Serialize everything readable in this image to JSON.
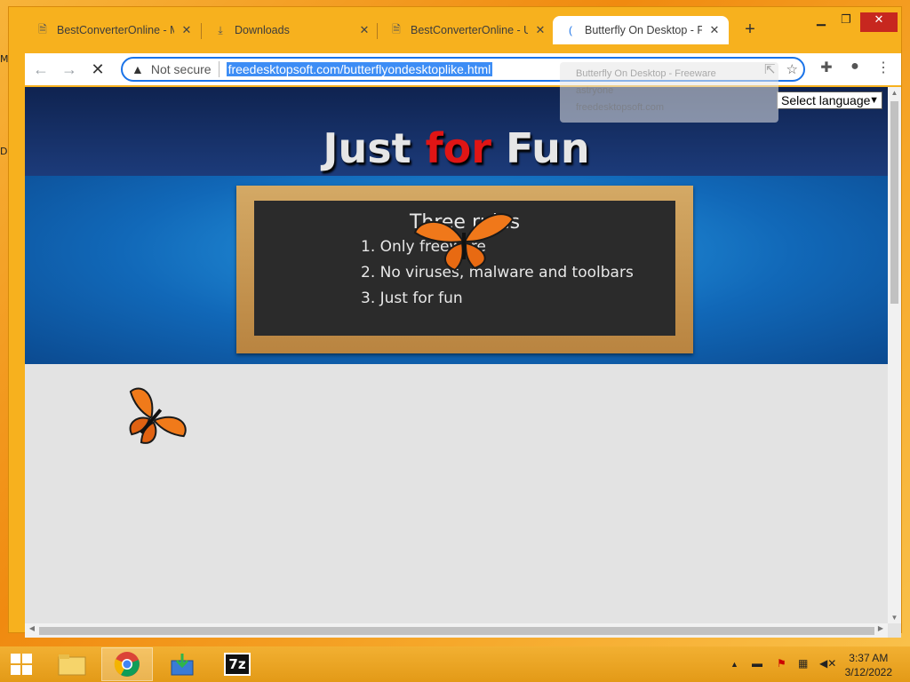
{
  "tabs": [
    {
      "label": "BestConverterOnline - M",
      "icon": "document-icon"
    },
    {
      "label": "Downloads",
      "icon": "download-icon"
    },
    {
      "label": "BestConverterOnline - Us",
      "icon": "document-icon"
    },
    {
      "label": "Butterfly On Desktop - Fr",
      "icon": "loading-icon",
      "active": true
    }
  ],
  "toolbar": {
    "security_label": "Not secure",
    "url": "freedesktopsoft.com/butterflyondesktoplike.html"
  },
  "omnibox_dropdown": {
    "line1": "Butterfly On Desktop - Freeware",
    "line2": "astryone",
    "line3": "freedesktopsoft.com"
  },
  "page": {
    "headline_part1": "Just ",
    "headline_part2": "for",
    "headline_part3": " Fun",
    "board_title": "Three rules",
    "rules": [
      "1. Only freeware",
      "2. No viruses, malware and toolbars",
      "3. Just for fun"
    ],
    "language_select": "Select language"
  },
  "taskbar": {
    "time": "3:37 AM",
    "date": "3/12/2022",
    "sevenzip_label": "7z"
  },
  "colors": {
    "accent": "#1a73e8",
    "desktop": "#f4a21a",
    "headline_red": "#e01515"
  }
}
